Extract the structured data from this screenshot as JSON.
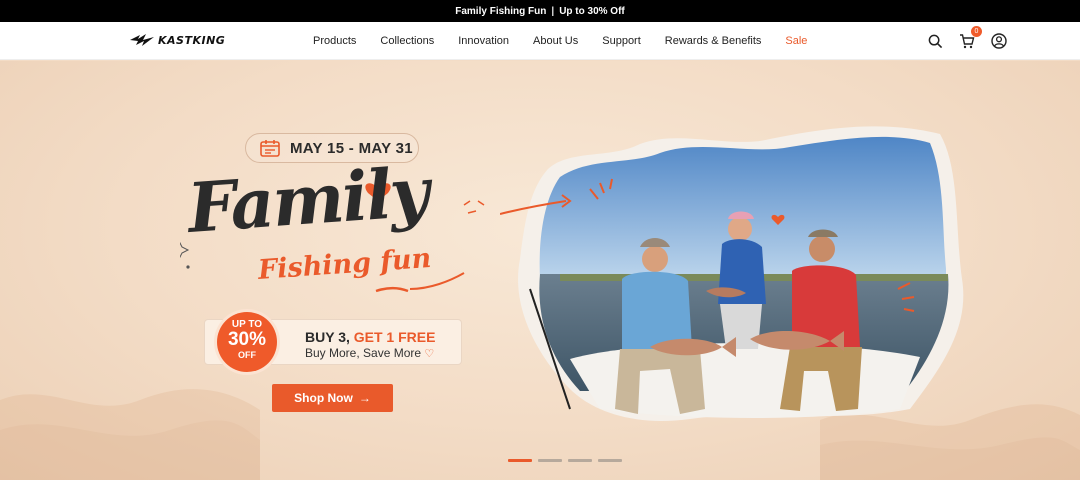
{
  "announcement": {
    "left": "Family Fishing Fun",
    "sep": "|",
    "right": "Up to 30% Off"
  },
  "brand": {
    "name": "KASTKING",
    "accent": "#ea5a2b"
  },
  "nav": [
    {
      "label": "Products"
    },
    {
      "label": "Collections"
    },
    {
      "label": "Innovation"
    },
    {
      "label": "About Us"
    },
    {
      "label": "Support"
    },
    {
      "label": "Rewards & Benefits"
    },
    {
      "label": "Sale"
    }
  ],
  "header_icons": {
    "search": "search-icon",
    "cart": "cart-icon",
    "account": "account-icon",
    "cart_count": "0"
  },
  "hero": {
    "date_range": "MAY 15 - MAY 31",
    "title": "Family",
    "subtitle": "Fishing fun",
    "badge_top": "UP TO",
    "badge_value": "30%",
    "badge_bottom": "OFF",
    "offer_prefix": "BUY 3, ",
    "offer_highlight": "GET 1 FREE",
    "offer_sub": "Buy More, Save More",
    "cta": "Shop Now",
    "cta_icon": "arrow-right-icon"
  },
  "carousel": {
    "slides": 4,
    "active": 0
  }
}
